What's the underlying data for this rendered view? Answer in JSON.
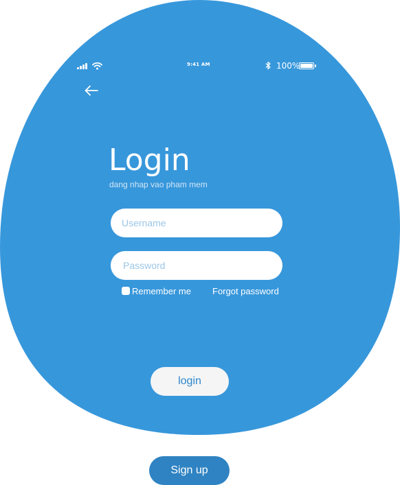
{
  "colors": {
    "background": "#ffffff",
    "card": "#3797db",
    "text_on_card": "#ffffff",
    "placeholder": "#9cc6e6",
    "subtitle": "#d2e6f6",
    "login_button_bg": "#f5f5f5",
    "login_button_text": "#2e86c9",
    "signup_button_bg": "#2f83c2"
  },
  "status_bar": {
    "time": "9:41 AM",
    "battery_percent": "100%",
    "icons": [
      "cellular-signal-icon",
      "wifi-icon",
      "bluetooth-icon",
      "battery-icon"
    ]
  },
  "nav": {
    "back_icon": "arrow-left-icon"
  },
  "header": {
    "title": "Login",
    "subtitle": "dang nhap vao pham mem"
  },
  "form": {
    "username": {
      "placeholder": "Username",
      "value": ""
    },
    "password": {
      "placeholder": "Password",
      "value": ""
    },
    "remember_me": {
      "label": "Remember me",
      "checked": false
    },
    "forgot_password": "Forgot password",
    "login_label": "login"
  },
  "footer": {
    "signup_label": "Sign up"
  }
}
